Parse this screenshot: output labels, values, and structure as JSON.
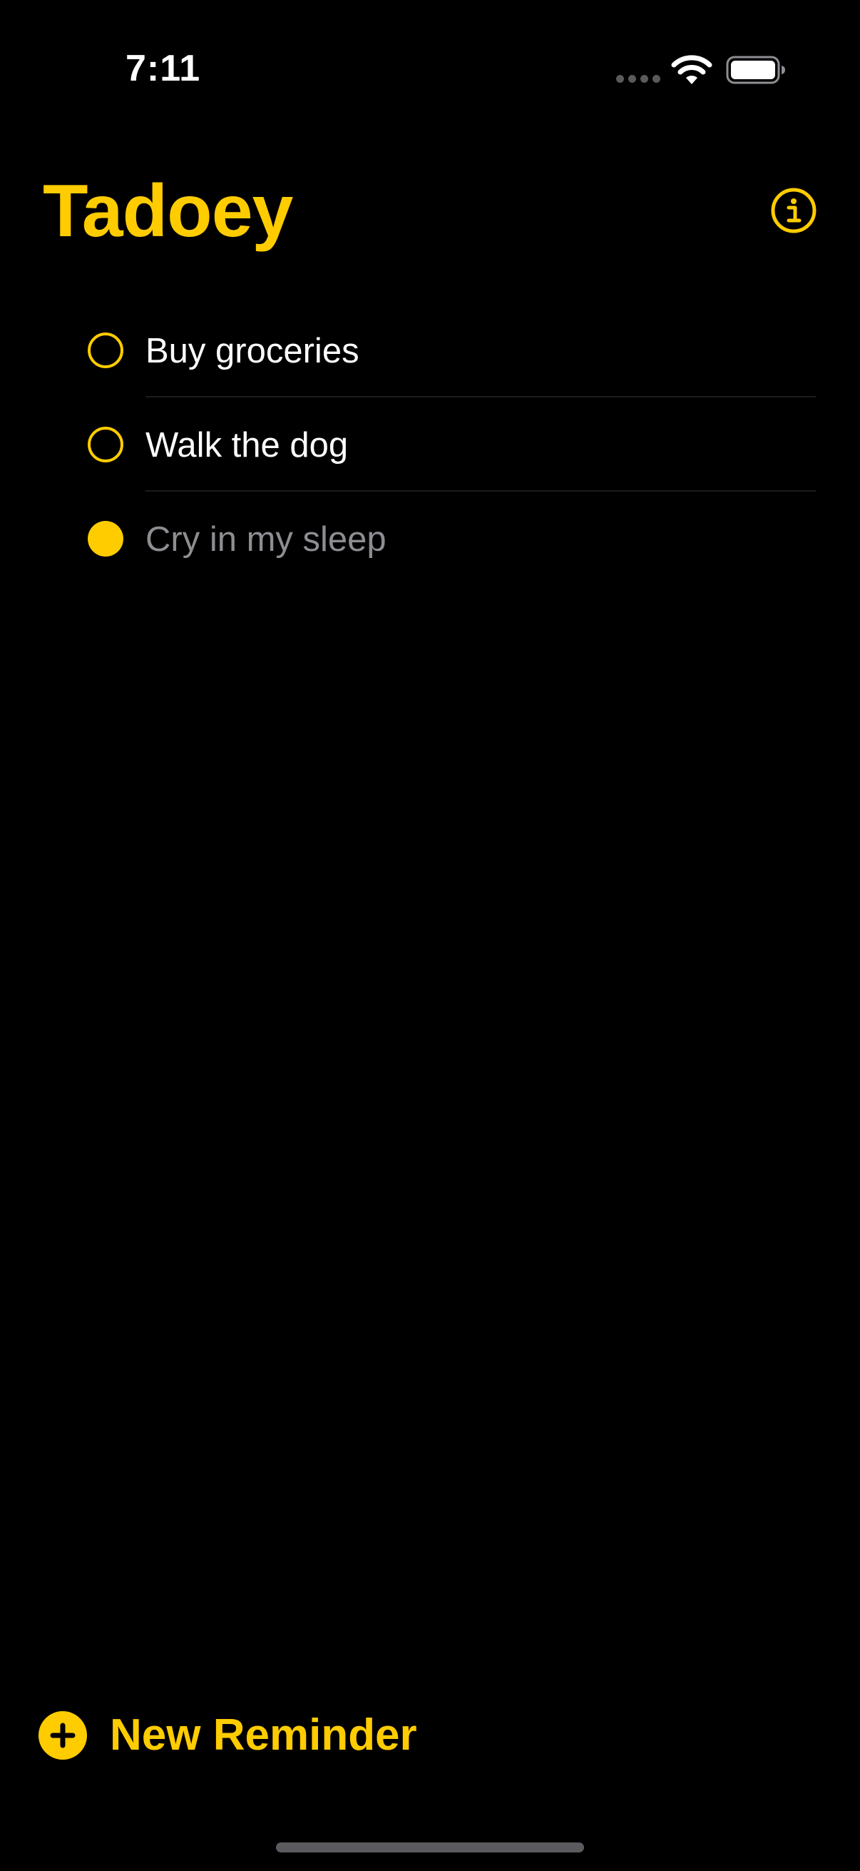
{
  "theme": {
    "accent": "#FFCC00",
    "background": "#000000",
    "text": "#FFFFFF",
    "completed_text": "#8D8D92",
    "separator": "#1C1C1E"
  },
  "status_bar": {
    "time": "7:11",
    "icons": [
      "cellular-signal-icon",
      "wifi-icon",
      "battery-icon"
    ],
    "battery_level": 1.0
  },
  "header": {
    "title": "Tadoey",
    "info_icon": "info-circle-icon"
  },
  "reminders": [
    {
      "text": "Buy groceries",
      "completed": false
    },
    {
      "text": "Walk the dog",
      "completed": false
    },
    {
      "text": "Cry in my sleep",
      "completed": true
    }
  ],
  "toolbar": {
    "new_reminder_label": "New Reminder",
    "new_reminder_icon": "plus-circle-icon"
  }
}
